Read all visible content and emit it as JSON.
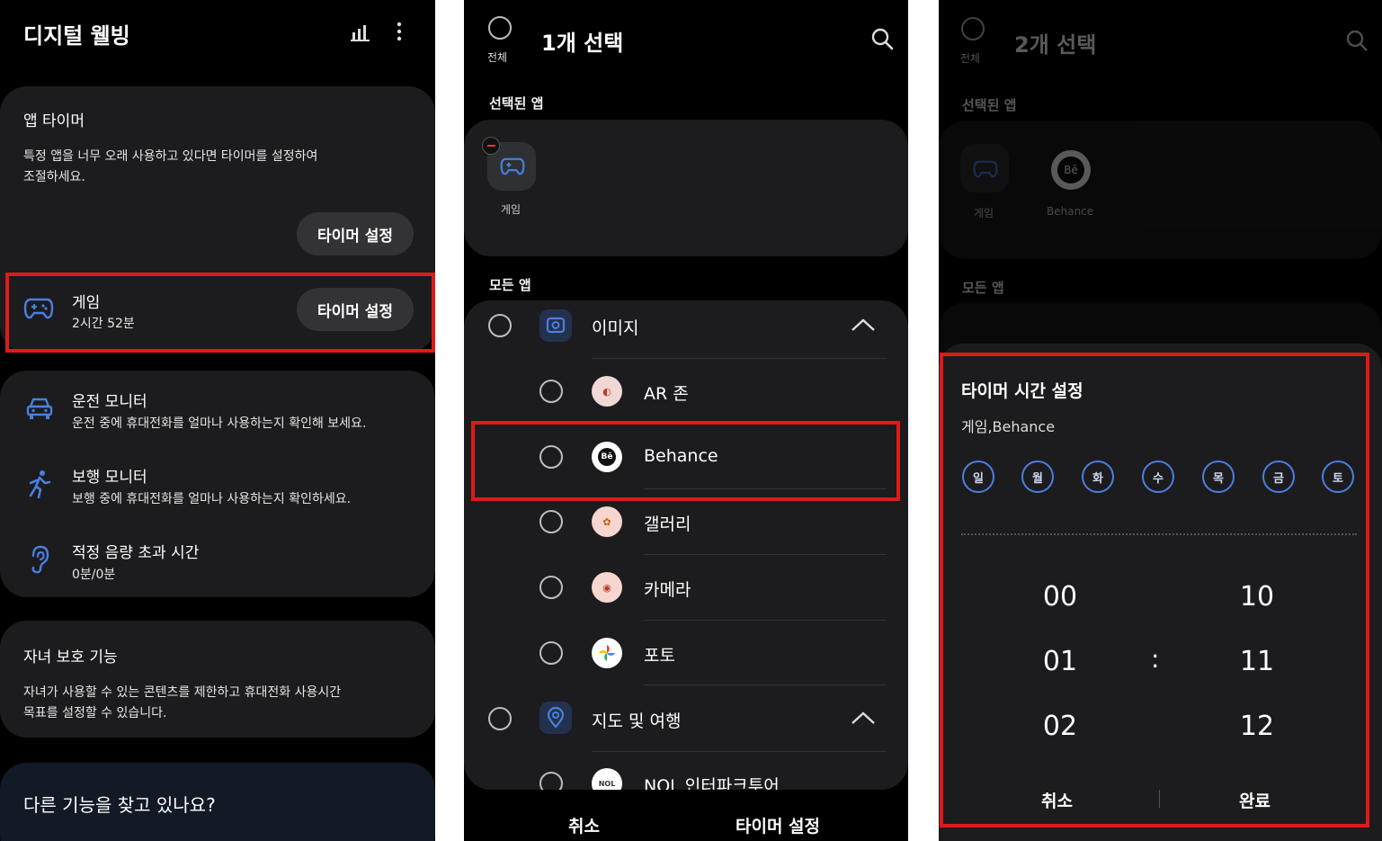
{
  "screen1": {
    "title": "디지털 웰빙",
    "app_timer": {
      "heading": "앱 타이머",
      "desc_line1": "특정 앱을 너무 오래 사용하고 있다면 타이머를 설정하여",
      "desc_line2": "조절하세요.",
      "button": "타이머 설정"
    },
    "game_row": {
      "name": "게임",
      "usage": "2시간 52분",
      "button": "타이머 설정"
    },
    "monitors": [
      {
        "title": "운전 모니터",
        "desc": "운전 중에 휴대전화를 얼마나 사용하는지 확인해 보세요."
      },
      {
        "title": "보행 모니터",
        "desc": "보행 중에 휴대전화를 얼마나 사용하는지 확인하세요."
      },
      {
        "title": "적정 음량 초과 시간",
        "desc": "0분/0분"
      }
    ],
    "parental": {
      "heading": "자녀 보호 기능",
      "desc_line1": "자녀가 사용할 수 있는 콘텐츠를 제한하고 휴대전화 사용시간",
      "desc_line2": "목표를 설정할 수 있습니다."
    },
    "footer": "다른 기능을 찾고 있나요?"
  },
  "screen2": {
    "all_label": "전체",
    "title": "1개 선택",
    "selected_header": "선택된 앱",
    "selected_apps": [
      "게임"
    ],
    "all_apps_header": "모든 앱",
    "categories": [
      {
        "name": "이미지",
        "apps": [
          "AR 존",
          "Behance",
          "갤러리",
          "카메라",
          "포토"
        ]
      },
      {
        "name": "지도 및 여행",
        "apps": [
          "NOL 인터파크투어"
        ]
      }
    ],
    "cancel": "취소",
    "confirm": "타이머 설정"
  },
  "screen3": {
    "all_label": "전체",
    "title": "2개 선택",
    "selected_header": "선택된 앱",
    "selected_apps": [
      "게임",
      "Behance"
    ],
    "all_apps_header": "모든 앱",
    "dialog": {
      "title": "타이머 시간 설정",
      "apps": "게임,Behance",
      "days": [
        "일",
        "월",
        "화",
        "수",
        "목",
        "금",
        "토"
      ],
      "hours": [
        "00",
        "01",
        "02"
      ],
      "minutes": [
        "10",
        "11",
        "12"
      ],
      "separator": ":",
      "cancel": "취소",
      "done": "완료"
    }
  },
  "colors": {
    "highlight": "#e01919",
    "accent": "#4a7fe0",
    "card": "#1c1c1e"
  }
}
